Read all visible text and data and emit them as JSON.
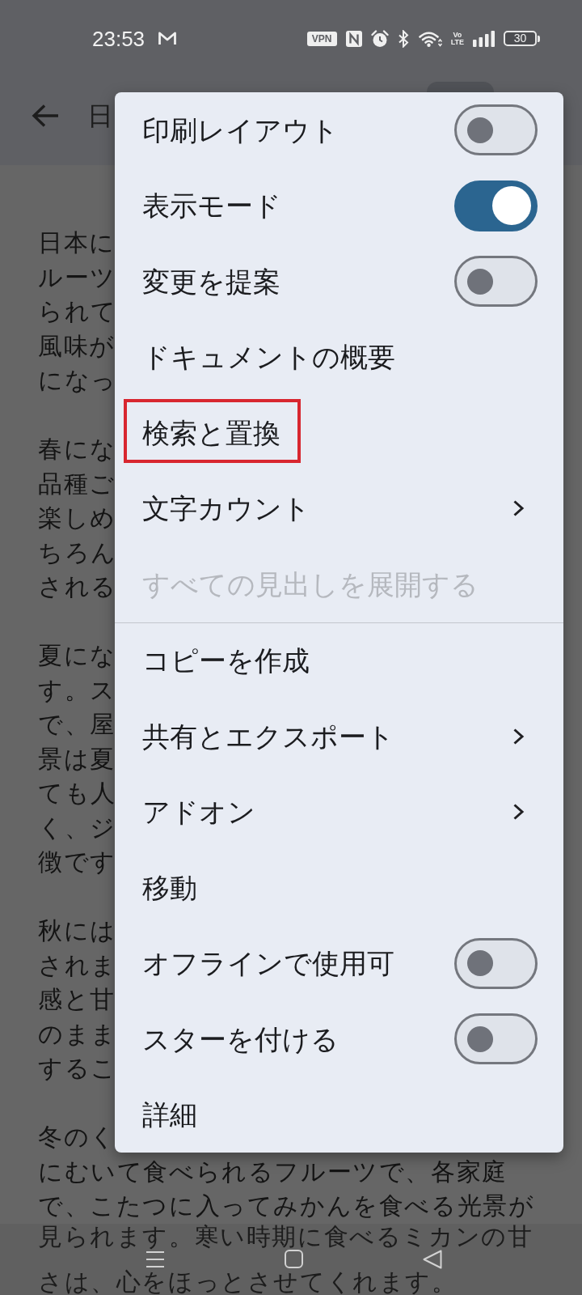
{
  "status_bar": {
    "time": "23:53",
    "vpn": "VPN",
    "network": "Vo LTE",
    "battery": "30"
  },
  "app_bar": {
    "title": "日"
  },
  "document": {
    "paragraphs": [
      [
        "日本に",
        "ルーツ",
        "られて",
        "風味が",
        "になっ"
      ],
      [
        "春にな",
        "品種ご",
        "楽しめ",
        "ちろん",
        "される"
      ],
      [
        "夏にな",
        "す。ス",
        "で、屋",
        "景は夏",
        "ても人",
        "く、ジ",
        "徴です"
      ],
      [
        "秋には",
        "されま",
        "感と甘",
        "のまま",
        "するこ"
      ],
      [
        "冬のく",
        "にむいて食べられるフルーツで、各家庭",
        "で、こたつに入ってみかんを食べる光景が"
      ]
    ]
  },
  "menu": {
    "sections": [
      {
        "items": [
          {
            "label": "印刷レイアウト",
            "kind": "toggle",
            "on": false,
            "disabled": false,
            "highlighted": false
          },
          {
            "label": "表示モード",
            "kind": "toggle",
            "on": true,
            "disabled": false,
            "highlighted": false
          },
          {
            "label": "変更を提案",
            "kind": "toggle",
            "on": false,
            "disabled": false,
            "highlighted": false
          },
          {
            "label": "ドキュメントの概要",
            "kind": "action",
            "disabled": false,
            "highlighted": false
          },
          {
            "label": "検索と置換",
            "kind": "action",
            "disabled": false,
            "highlighted": true
          },
          {
            "label": "文字カウント",
            "kind": "submenu",
            "disabled": false,
            "highlighted": false
          },
          {
            "label": "すべての見出しを展開する",
            "kind": "action",
            "disabled": true,
            "highlighted": false
          }
        ]
      },
      {
        "items": [
          {
            "label": "コピーを作成",
            "kind": "action",
            "disabled": false,
            "highlighted": false
          },
          {
            "label": "共有とエクスポート",
            "kind": "submenu",
            "disabled": false,
            "highlighted": false
          },
          {
            "label": "アドオン",
            "kind": "submenu",
            "disabled": false,
            "highlighted": false
          },
          {
            "label": "移動",
            "kind": "action",
            "disabled": false,
            "highlighted": false
          },
          {
            "label": "オフラインで使用可",
            "kind": "toggle",
            "on": false,
            "disabled": false,
            "highlighted": false
          },
          {
            "label": "スターを付ける",
            "kind": "toggle",
            "on": false,
            "disabled": false,
            "highlighted": false
          },
          {
            "label": "詳細",
            "kind": "action",
            "disabled": false,
            "highlighted": false
          }
        ]
      }
    ]
  },
  "navigation_bar": {
    "document_text_behind": [
      "見られます。寒い時期に食べるミカンの甘",
      "さは、心をほっとさせてくれます。"
    ]
  }
}
